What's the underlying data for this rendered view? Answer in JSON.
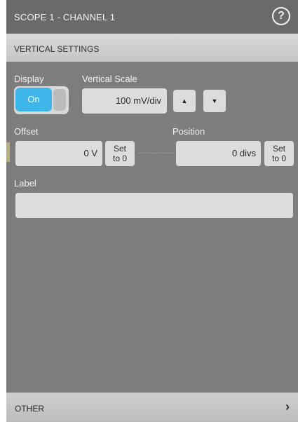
{
  "window": {
    "title": "SCOPE 1 - CHANNEL 1",
    "help_icon": "?"
  },
  "section": {
    "title": "VERTICAL SETTINGS"
  },
  "display": {
    "label": "Display",
    "value": "On"
  },
  "vertical_scale": {
    "label": "Vertical Scale",
    "value": "100 mV/div",
    "up_glyph": "▲",
    "down_glyph": "▼"
  },
  "offset": {
    "label": "Offset",
    "value": "0 V",
    "set_line1": "Set",
    "set_line2": "to 0"
  },
  "position": {
    "label": "Position",
    "value": "0 divs",
    "set_line1": "Set",
    "set_line2": "to 0"
  },
  "label_field": {
    "label": "Label",
    "value": ""
  },
  "footer": {
    "title": "OTHER",
    "chevron": "›"
  }
}
